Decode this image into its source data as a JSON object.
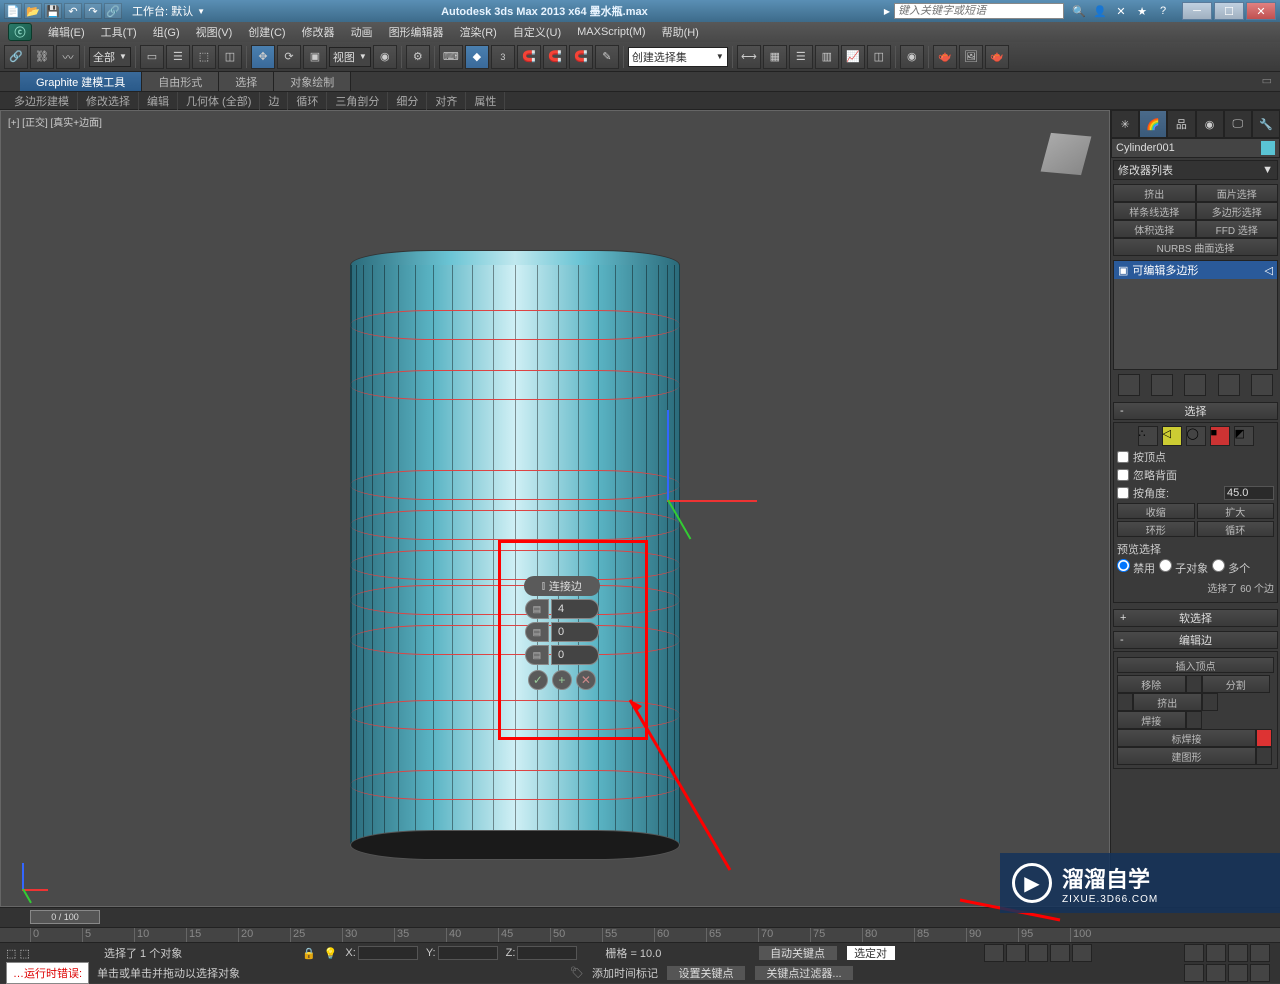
{
  "title_bar": {
    "workspace_label": "工作台: 默认",
    "app_title": "Autodesk 3ds Max  2013 x64    墨水瓶.max",
    "search_placeholder": "键入关键字或短语",
    "help_icon": "?"
  },
  "menu": {
    "items": [
      "编辑(E)",
      "工具(T)",
      "组(G)",
      "视图(V)",
      "创建(C)",
      "修改器",
      "动画",
      "图形编辑器",
      "渲染(R)",
      "自定义(U)",
      "MAXScript(M)",
      "帮助(H)"
    ]
  },
  "main_toolbar": {
    "filter_dropdown": "全部",
    "view_dropdown": "视图",
    "selection_set": "创建选择集"
  },
  "ribbon": {
    "tabs": [
      "Graphite 建模工具",
      "自由形式",
      "选择",
      "对象绘制"
    ],
    "sub": [
      "多边形建模",
      "修改选择",
      "编辑",
      "几何体 (全部)",
      "边",
      "循环",
      "三角剖分",
      "细分",
      "对齐",
      "属性"
    ]
  },
  "viewport": {
    "label": "[+] [正交] [真实+边面]"
  },
  "caddy": {
    "header": "连接边",
    "spinners": [
      "4",
      "0",
      "0"
    ]
  },
  "command_panel": {
    "object_name": "Cylinder001",
    "modifier_list_label": "修改器列表",
    "modifier_buttons": [
      "挤出",
      "面片选择",
      "样条线选择",
      "多边形选择",
      "体积选择",
      "FFD 选择"
    ],
    "nurbs_label": "NURBS 曲面选择",
    "stack_item": "可编辑多边形",
    "rollout_select": "选择",
    "check_by_vertex": "按顶点",
    "check_ignore_backfacing": "忽略背面",
    "check_by_angle": "按角度:",
    "angle_value": "45.0",
    "btn_shrink": "收缩",
    "btn_grow": "扩大",
    "btn_ring": "环形",
    "btn_loop": "循环",
    "preview_label": "预览选择",
    "radio_disable": "禁用",
    "radio_subobj": "子对象",
    "radio_multi": "多个",
    "selection_info": "选择了 60 个边",
    "rollout_soft": "软选择",
    "rollout_edit_edge": "编辑边",
    "btn_insert_vertex": "插入顶点",
    "btn_remove": "移除",
    "btn_split": "分割",
    "btn_extrude": "挤出",
    "btn_weld": "焊接",
    "btn_target_weld": "标焊接",
    "btn_bridge": "建图形"
  },
  "timeline": {
    "slider_label": "0 / 100",
    "ticks": [
      "0",
      "5",
      "10",
      "15",
      "20",
      "25",
      "30",
      "35",
      "40",
      "45",
      "50",
      "55",
      "60",
      "65",
      "70",
      "75",
      "80",
      "85",
      "90",
      "95",
      "100"
    ]
  },
  "status": {
    "selection": "选择了 1 个对象",
    "x_label": "X:",
    "y_label": "Y:",
    "z_label": "Z:",
    "grid_label": "栅格 = 10.0",
    "autokey": "自动关键点",
    "setkey": "设置关键点",
    "selected_label": "选定对",
    "keyfilters": "关键点过滤器..."
  },
  "prompt": {
    "text": "单击或单击并拖动以选择对象",
    "add_time_tag": "添加时间标记",
    "error": "…运行时错误:"
  },
  "watermark": {
    "main": "溜溜自学",
    "url": "ZIXUE.3D66.COM"
  }
}
